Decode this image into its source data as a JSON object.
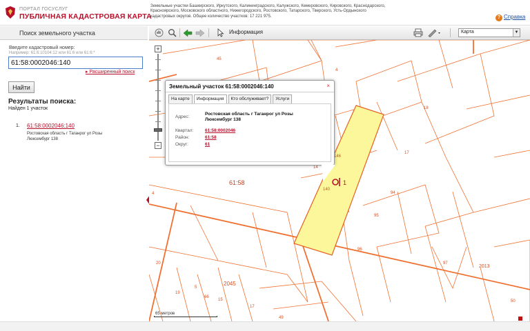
{
  "header": {
    "portal": "ПОРТАЛ ГОСУСЛУГ",
    "title": "ПУБЛИЧНАЯ КАДАСТРОВАЯ КАРТА",
    "notice": "Земельные участки Башкирского, Иркутского, Калининградского, Калужского, Кемеровского, Кировского, Краснодарского, Красноярского, Московского областного, Нижегородского, Ростовского, Татарского, Тверского, Усть-Ордынского кадастровых округов. Общее количество участков: 17 221 975.",
    "help_label": "Справка",
    "help_icon": "?"
  },
  "left": {
    "title": "Поиск земельного участка",
    "cad_label": "Введите кадастровый номер:",
    "example": "Например: 61:6:10104:12 или 61:6 или 61:6:*",
    "search_value": "61:58:0002046:140",
    "advanced": "Расширенный поиск",
    "find_button": "Найти",
    "results_title": "Результаты поиска:",
    "results_count": "Найден 1 участок",
    "results": [
      {
        "num": "1.",
        "cad": "61:58:0002046:140",
        "address": "Ростовская область г Таганрог ул Розы Люксембург 138"
      }
    ]
  },
  "toolbar": {
    "info_label": "Информация",
    "layer_select": "Карта"
  },
  "popup": {
    "title": "Земельный участок 61:58:0002046:140",
    "close": "×",
    "tabs": [
      "На карте",
      "Информация",
      "Кто обслуживает?",
      "Услуги"
    ],
    "address_label": "Адрес:",
    "address_value": "Ростовская область г Таганрог ул Розы Люксембург 138",
    "quarter_label": "Квартал:",
    "quarter_value": "61:58:0002046",
    "district_label": "Район:",
    "district_value": "61:58",
    "okrug_label": "Округ:",
    "okrug_value": "61"
  },
  "map": {
    "scale_label": "65 метров",
    "labels": [
      "45",
      "4",
      "18",
      "17",
      "146",
      "140",
      "94",
      "95",
      "96",
      "61:58",
      "2013",
      "97",
      "50",
      "20",
      "2045",
      "19",
      "66",
      "15",
      "17",
      "49",
      "14",
      "4",
      "5"
    ],
    "selected_marker": "1",
    "parcel_fill": "#fbf79a",
    "line_color": "#f07030"
  }
}
